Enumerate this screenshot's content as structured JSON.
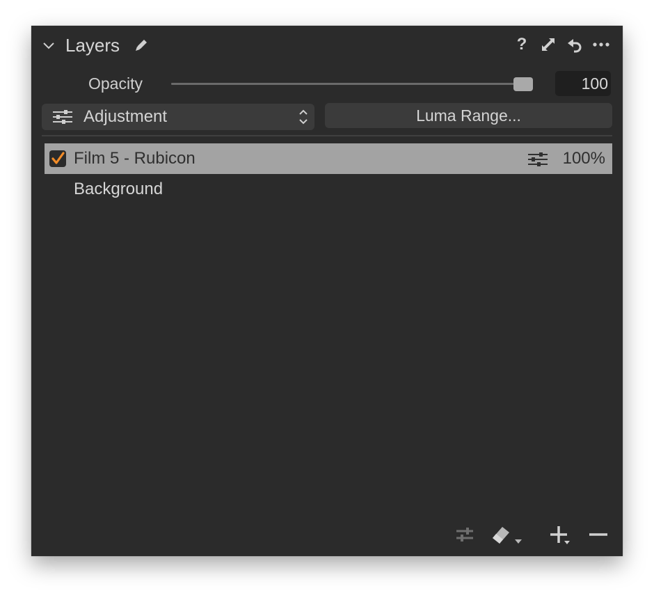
{
  "header": {
    "title": "Layers",
    "icons": [
      "chevron-down-icon",
      "pencil-icon",
      "help-icon",
      "expand-icon",
      "reset-icon",
      "more-icon"
    ],
    "help_glyph": "?",
    "more_glyph": "…"
  },
  "opacity": {
    "label": "Opacity",
    "value": "100",
    "level_percent": 100
  },
  "layer_type_dropdown": {
    "selected": "Adjustment"
  },
  "luma_button": {
    "label": "Luma Range..."
  },
  "layers": [
    {
      "name": "Film 5 - Rubicon",
      "checked": true,
      "opacity": "100%",
      "selected": true
    },
    {
      "name": "Background"
    }
  ],
  "footer": {
    "icons": [
      "sliders-swap-icon",
      "eraser-icon",
      "add-layer-icon",
      "remove-layer-icon"
    ]
  },
  "colors": {
    "panel_bg": "#2b2b2b",
    "selected_row": "#a3a3a3",
    "checkbox_check": "#f28c28"
  }
}
